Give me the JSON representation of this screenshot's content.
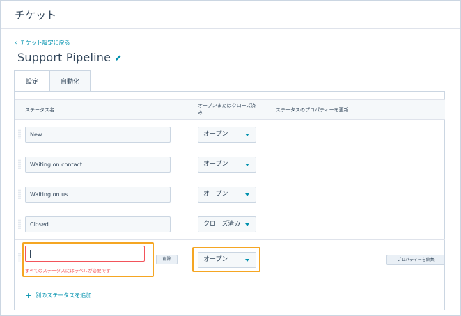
{
  "app": {
    "title": "チケット"
  },
  "nav": {
    "back_label": "チケット設定に戻る"
  },
  "pipeline": {
    "name": "Support Pipeline"
  },
  "tabs": [
    {
      "label": "設定",
      "active": true
    },
    {
      "label": "自動化",
      "active": false
    }
  ],
  "table": {
    "headers": {
      "status_name": "ステータス名",
      "open_closed": "オープンまたはクローズ済み",
      "properties": "ステータスのプロパティーを更新"
    },
    "rows": [
      {
        "name": "New",
        "status": "オープン"
      },
      {
        "name": "Waiting on contact",
        "status": "オープン"
      },
      {
        "name": "Waiting on us",
        "status": "オープン"
      },
      {
        "name": "Closed",
        "status": "クローズ済み"
      }
    ],
    "new_row": {
      "name": "",
      "status": "オープン",
      "error": "すべてのステータスにはラベルが必要です",
      "delete_label": "削除",
      "edit_properties_label": "プロパティーを編集"
    }
  },
  "actions": {
    "add_status_label": "別のステータスを追加"
  },
  "colors": {
    "accent": "#0091ae",
    "error": "#f2545b",
    "highlight": "#f5a623",
    "text": "#33475b"
  }
}
